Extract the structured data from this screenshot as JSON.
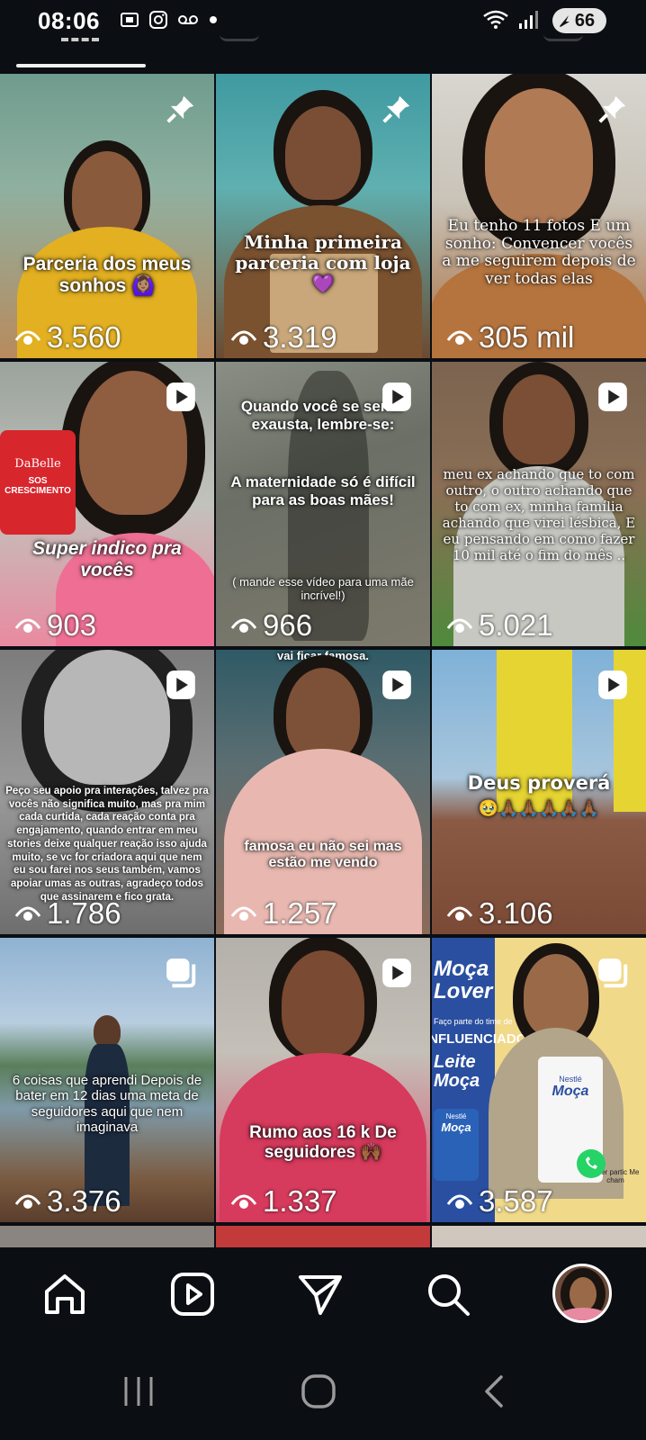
{
  "status_bar": {
    "time": "08:06",
    "battery": "66",
    "icons_left": [
      "screenshot-icon",
      "instagram-icon",
      "voicemail-icon",
      "dot-icon"
    ],
    "icons_right": [
      "wifi-icon",
      "signal-icon",
      "battery-icon"
    ]
  },
  "profile_tabs": {
    "active_index": 0,
    "tabs": [
      "grid-tab",
      "reels-tab",
      "tagged-tab",
      "other-tab"
    ]
  },
  "posts": [
    {
      "caption": "Parceria dos meus sonhos 🙆🏽‍♀️",
      "views": "3.560",
      "badge": "pin-icon"
    },
    {
      "caption": "Minha primeira parceria com loja 💜",
      "views": "3.319",
      "badge": "pin-icon"
    },
    {
      "caption": "Eu tenho 11 fotos E um sonho: Convencer vocês a me seguirem depois de ver todas elas",
      "views": "305 mil",
      "badge": "pin-icon"
    },
    {
      "caption": "Super indico pra vocês",
      "views": "903",
      "badge": "reel-icon",
      "product_brand": "DaBelle",
      "product_name": "SOS CRESCIMENTO"
    },
    {
      "caption": "Quando você se sentir exausta, lembre-se:",
      "caption2": "A maternidade só é difícil para as boas mães!",
      "caption3": "( mande esse vídeo para uma mãe incrível!)",
      "views": "966",
      "badge": "reel-icon"
    },
    {
      "caption": "meu ex achando que to com outro, o outro achando que to com ex, minha família achando que virei lésbica, E eu pensando em como fazer 10 mil até o fim do mês ..",
      "views": "5.021",
      "badge": "reel-icon"
    },
    {
      "caption": "Peço seu apoio pra interações, talvez pra vocês não significa muito, mas pra mim cada curtida, cada reação conta pra engajamento, quando entrar em meu stories deixe qualquer reação isso ajuda muito, se vc for criadora aqui que nem eu sou farei nos seus também, vamos apoiar umas as outras, agradeço todos que assinarem e fico grata.",
      "views": "1.786",
      "badge": "reel-icon"
    },
    {
      "caption_top": "vai ficar famosa.",
      "caption": "famosa eu não sei mas estão me vendo",
      "views": "1.257",
      "badge": "reel-icon"
    },
    {
      "caption": "Deus proverá",
      "emojis": "🥹🙏🏾🙏🏾🙏🏾🙏🏾🙏🏾",
      "views": "3.106",
      "badge": "reel-icon"
    },
    {
      "caption": "6 coisas que aprendi Depois de bater em 12 dias uma meta de seguidores aqui que nem imaginava",
      "views": "3.376",
      "badge": "carousel-icon"
    },
    {
      "caption": "Rumo aos 16 k De seguidores 🙌🏾",
      "views": "1.337",
      "badge": "reel-icon"
    },
    {
      "caption": "Moça Lover",
      "subcaption": "Faço parte do time de",
      "big": "INFLUENCIADORES",
      "brand": "Leite Moça",
      "apron": "Moça",
      "nestle": "Nestlé",
      "views": "3.587",
      "badge": "carousel-icon",
      "corner": "Quer partic Me cham"
    }
  ],
  "nav": [
    "home-icon",
    "reels-icon",
    "direct-icon",
    "search-icon",
    "profile-avatar"
  ],
  "system_nav": [
    "recents-icon",
    "home-circle-icon",
    "back-icon"
  ]
}
